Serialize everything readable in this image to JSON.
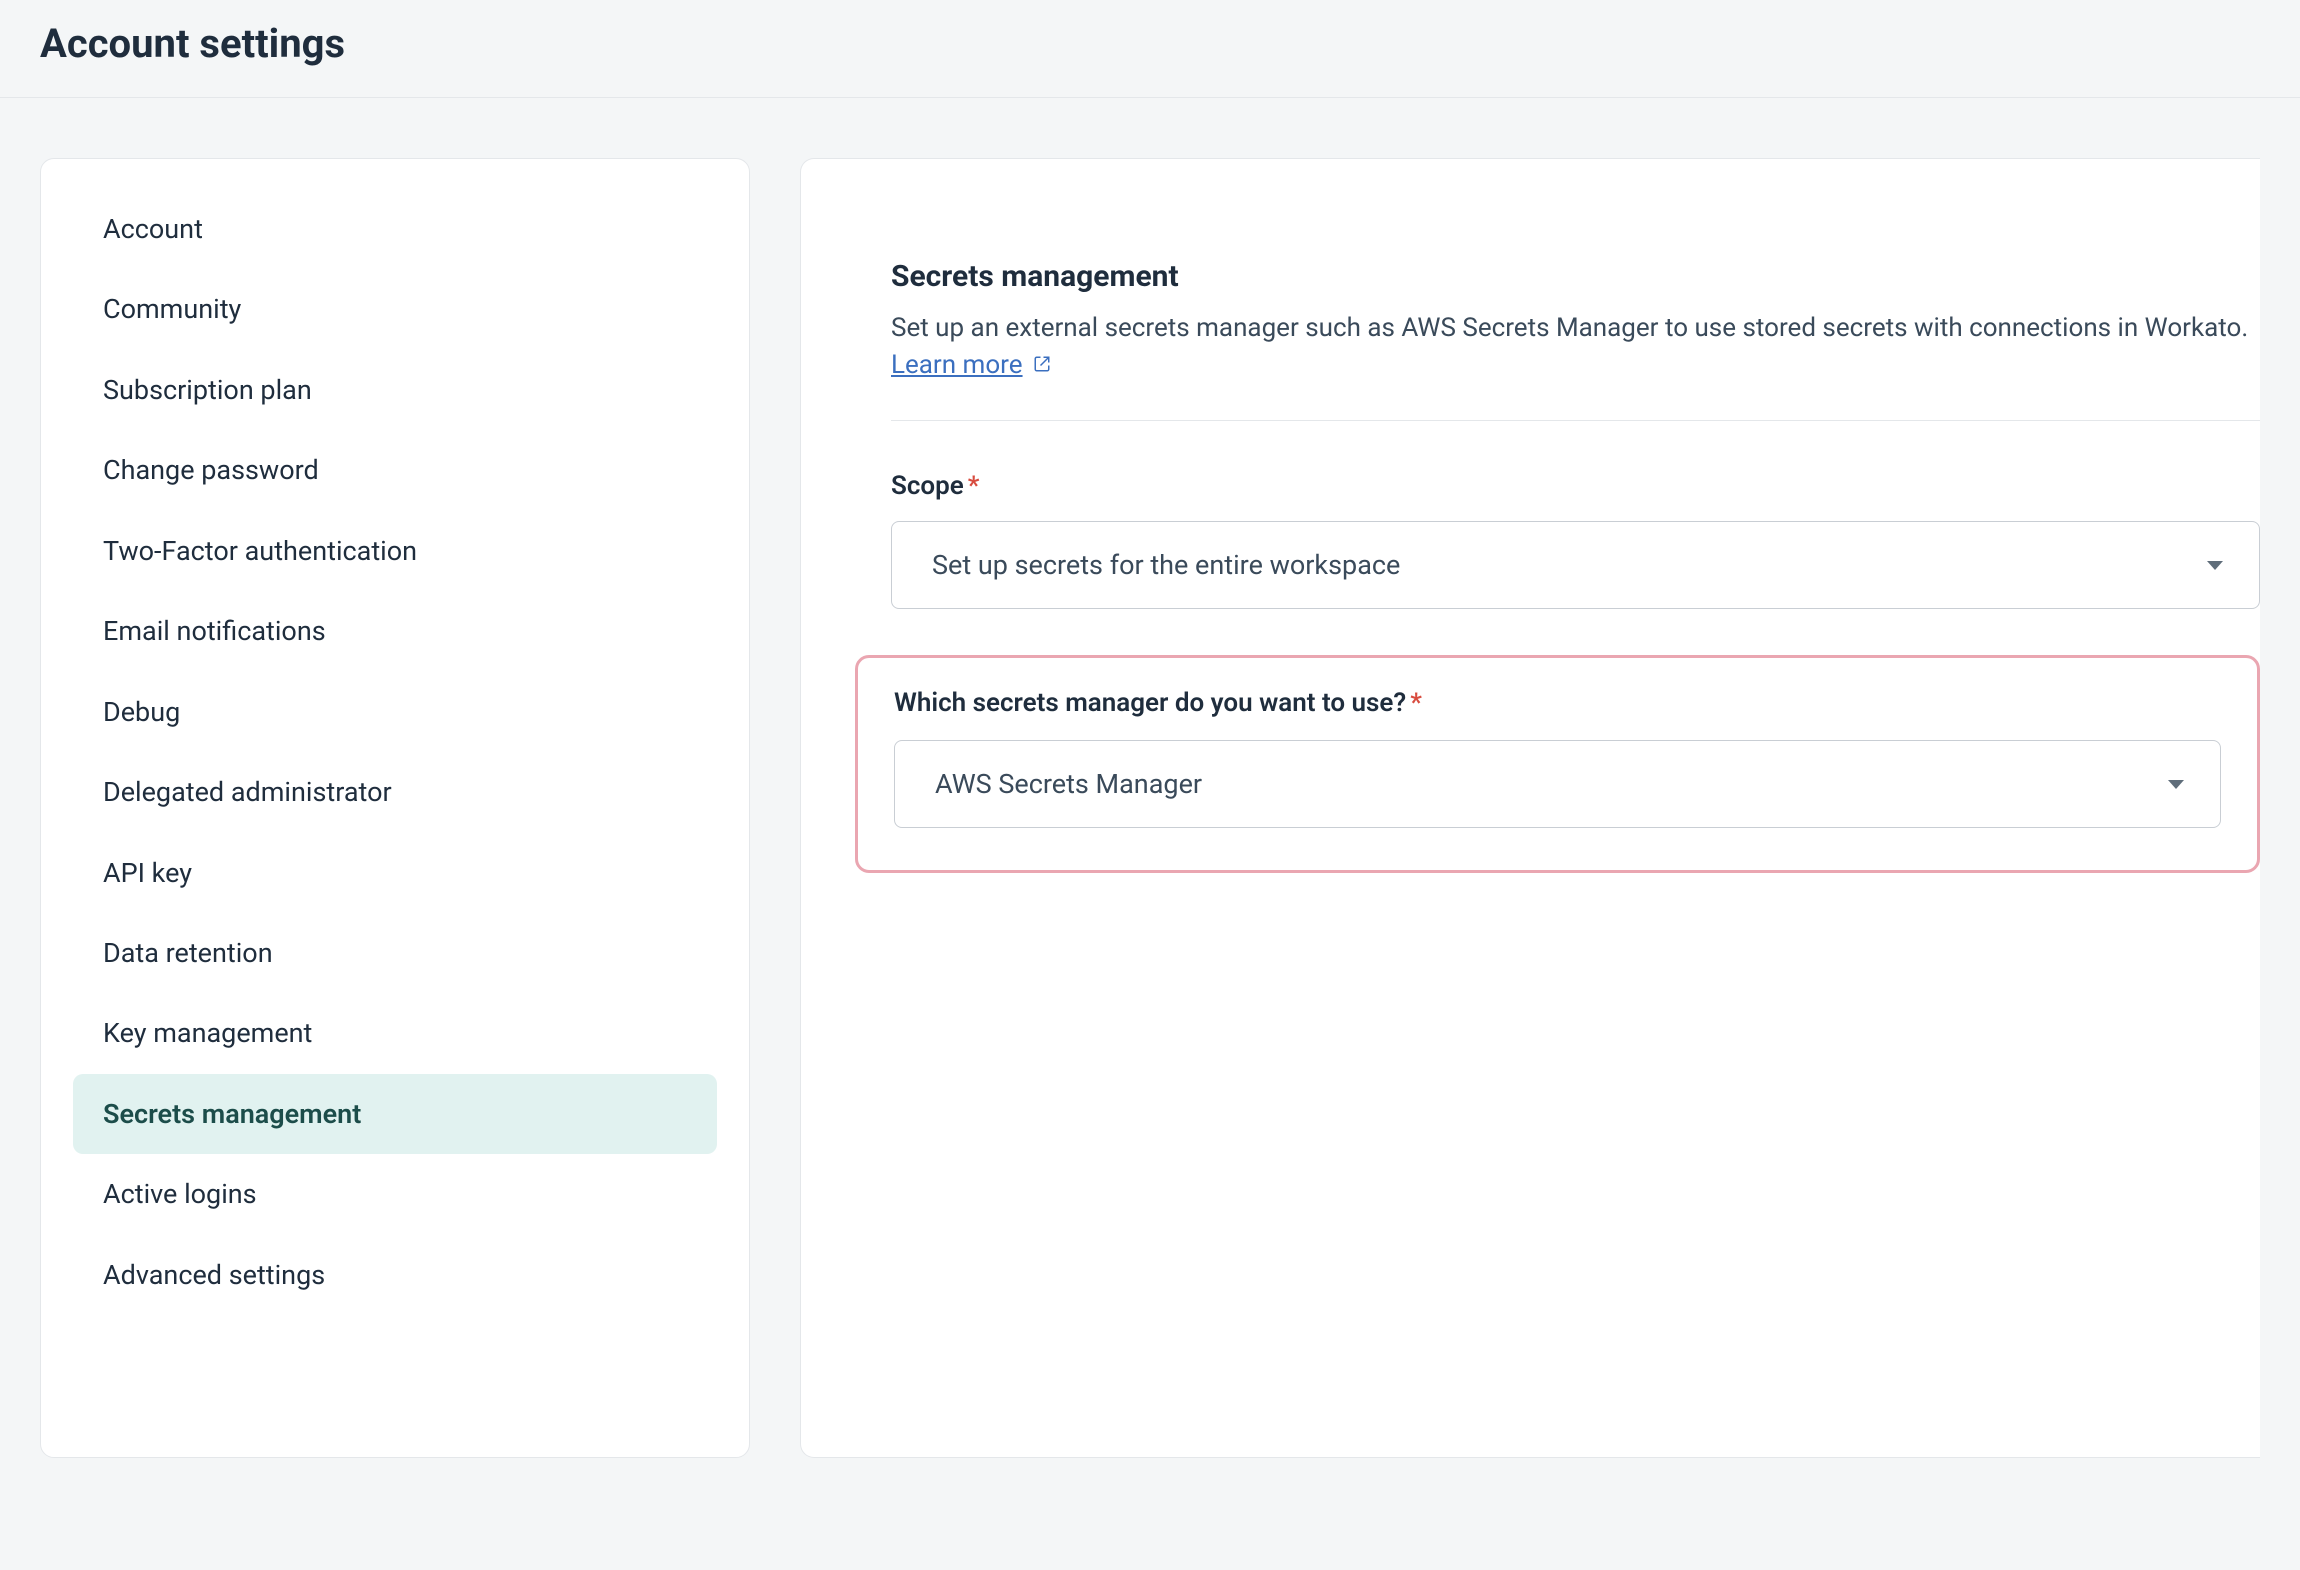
{
  "page": {
    "title": "Account settings"
  },
  "sidebar": {
    "items": [
      {
        "id": "account",
        "label": "Account",
        "active": false
      },
      {
        "id": "community",
        "label": "Community",
        "active": false
      },
      {
        "id": "subscription-plan",
        "label": "Subscription plan",
        "active": false
      },
      {
        "id": "change-password",
        "label": "Change password",
        "active": false
      },
      {
        "id": "two-factor-authentication",
        "label": "Two-Factor authentication",
        "active": false
      },
      {
        "id": "email-notifications",
        "label": "Email notifications",
        "active": false
      },
      {
        "id": "debug",
        "label": "Debug",
        "active": false
      },
      {
        "id": "delegated-administrator",
        "label": "Delegated administrator",
        "active": false
      },
      {
        "id": "api-key",
        "label": "API key",
        "active": false
      },
      {
        "id": "data-retention",
        "label": "Data retention",
        "active": false
      },
      {
        "id": "key-management",
        "label": "Key management",
        "active": false
      },
      {
        "id": "secrets-management",
        "label": "Secrets management",
        "active": true
      },
      {
        "id": "active-logins",
        "label": "Active logins",
        "active": false
      },
      {
        "id": "advanced-settings",
        "label": "Advanced settings",
        "active": false
      }
    ]
  },
  "main": {
    "heading": "Secrets management",
    "description": "Set up an external secrets manager such as AWS Secrets Manager to use stored secrets with connections in Workato.",
    "learn_more_label": "Learn more",
    "fields": {
      "scope": {
        "label": "Scope",
        "required": true,
        "value": "Set up secrets for the entire workspace"
      },
      "manager": {
        "label": "Which secrets manager do you want to use?",
        "required": true,
        "value": "AWS Secrets Manager",
        "highlighted": true
      }
    }
  },
  "colors": {
    "accent_teal": "#e1f2f0",
    "link_blue": "#3b6fbf",
    "required_red": "#d84c3f",
    "highlight_pink": "#eaa6b1"
  }
}
